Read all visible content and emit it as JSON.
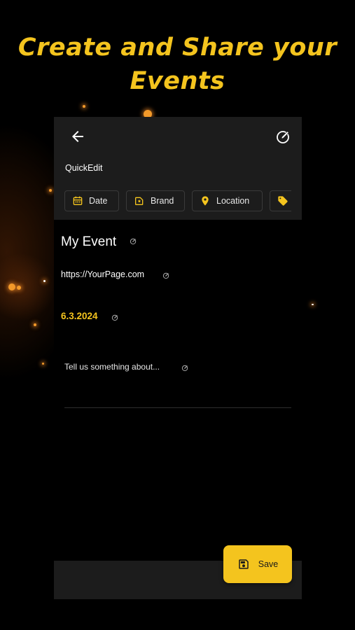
{
  "promo": {
    "headline_line1": "Create and Share your",
    "headline_line2": "Events"
  },
  "appbar": {
    "section_label": "QuickEdit",
    "chips": [
      {
        "label": "Date",
        "icon": "calendar-icon"
      },
      {
        "label": "Brand",
        "icon": "brand-icon"
      },
      {
        "label": "Location",
        "icon": "location-pin-icon"
      },
      {
        "label": "",
        "icon": "tag-icon"
      }
    ]
  },
  "event": {
    "title": "My Event",
    "url": "https://YourPage.com",
    "date": "6.3.2024",
    "description_placeholder": "Tell us something about..."
  },
  "actions": {
    "save_label": "Save"
  },
  "colors": {
    "accent": "#f4c41e",
    "appbar_bg": "#1c1c1c",
    "background": "#000000"
  }
}
